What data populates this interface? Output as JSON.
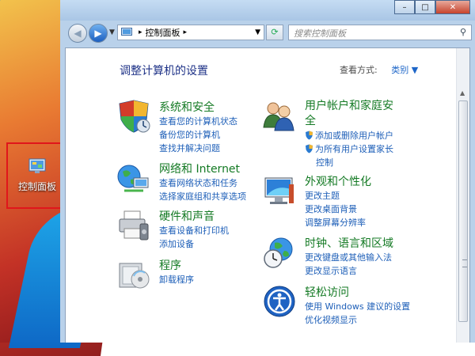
{
  "desktop": {
    "icon_label": "控制面板"
  },
  "window": {
    "caption": {
      "minimize": "–",
      "maximize": "□",
      "close": "✕"
    },
    "breadcrumb": "控制面板",
    "breadcrumb_sep": "▸",
    "search_placeholder": "搜索控制面板"
  },
  "main": {
    "title": "调整计算机的设置",
    "view_by_label": "查看方式:",
    "view_by_value": "类别 ▼",
    "categories_left": [
      {
        "title": "系统和安全",
        "links": [
          "查看您的计算机状态",
          "备份您的计算机",
          "查找并解决问题"
        ]
      },
      {
        "title": "网络和 Internet",
        "links": [
          "查看网络状态和任务",
          "选择家庭组和共享选项"
        ]
      },
      {
        "title": "硬件和声音",
        "links": [
          "查看设备和打印机",
          "添加设备"
        ]
      },
      {
        "title": "程序",
        "links": [
          "卸载程序"
        ]
      }
    ],
    "categories_right": [
      {
        "title_line1": "用户帐户和家庭安",
        "title_line2": "全",
        "links": [
          "添加或删除用户帐户",
          "为所有用户设置家长",
          "控制"
        ]
      },
      {
        "title": "外观和个性化",
        "links": [
          "更改主题",
          "更改桌面背景",
          "调整屏幕分辨率"
        ]
      },
      {
        "title": "时钟、语言和区域",
        "links": [
          "更改键盘或其他输入法",
          "更改显示语言"
        ]
      },
      {
        "title": "轻松访问",
        "links": [
          "使用 Windows 建议的设置",
          "优化视频显示"
        ]
      }
    ]
  },
  "icons": {
    "system": "shield-icon",
    "network": "globe-network-icon",
    "hardware": "printer-icon",
    "programs": "programs-icon",
    "users": "users-icon",
    "appearance": "monitor-icon",
    "clock": "clock-globe-icon",
    "access": "accessibility-icon"
  }
}
